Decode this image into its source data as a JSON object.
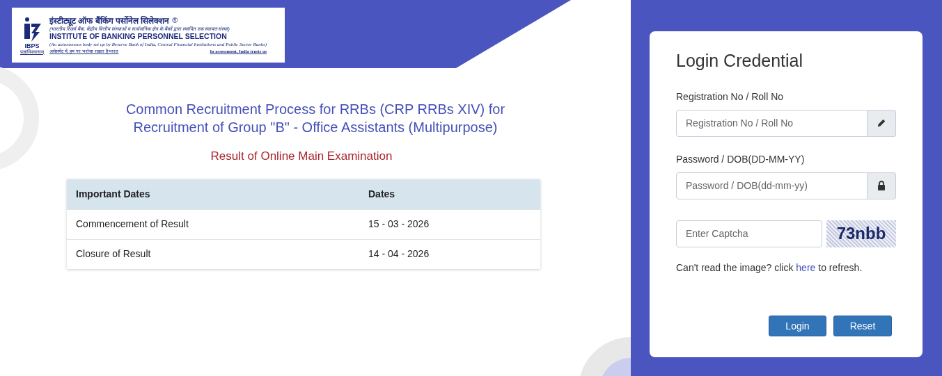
{
  "logo": {
    "mark": "IBPS",
    "motto": "प्रज्ञाविश्वासम्",
    "title_hindi": "इंस्टीट्यूट ऑफ बैंकिंग पर्सोनेल सिलेक्शन",
    "registered": "®",
    "subtitle_hindi": "(भारतीय रिज़र्व बैंक, केंद्रीय वित्तीय संस्थाओं व सार्वजनिक क्षेत्र के बैंकों द्वारा स्थापित एक स्वायत्त संस्था)",
    "title": "INSTITUTE OF BANKING PERSONNEL SELECTION",
    "subtitle": "(An autonomous body set up by Reserve Bank of India, Central Financial Institutions and Public Sector Banks)",
    "tagline_hindi": "असेसमेंट में, हम पर भरोसा रखता है भारत",
    "tagline": "In assessment, India trusts us"
  },
  "heading": "Common Recruitment Process for RRBs (CRP RRBs XIV) for Recruitment of Group \"B\" - Office Assistants (Multipurpose)",
  "subheading": "Result of Online Main Examination",
  "table": {
    "columns": [
      "Important Dates",
      "Dates"
    ],
    "rows": [
      [
        "Commencement of Result",
        "15 - 03 - 2026"
      ],
      [
        "Closure of Result",
        "14 - 04 - 2026"
      ]
    ]
  },
  "login": {
    "title": "Login Credential",
    "fields": [
      {
        "label": "Registration No / Roll No",
        "placeholder": "Registration No / Roll No",
        "kind": "pencil"
      },
      {
        "label": "Password / DOB(DD-MM-YY)",
        "placeholder": "Password / DOB(dd-mm-yy)",
        "kind": "lock"
      }
    ],
    "captcha": {
      "placeholder": "Enter Captcha",
      "code": "73nbb"
    },
    "refresh": {
      "before": "Can't read the image? click",
      "link": "here",
      "after": "to refresh."
    },
    "buttons": [
      "Login",
      "Reset"
    ]
  }
}
